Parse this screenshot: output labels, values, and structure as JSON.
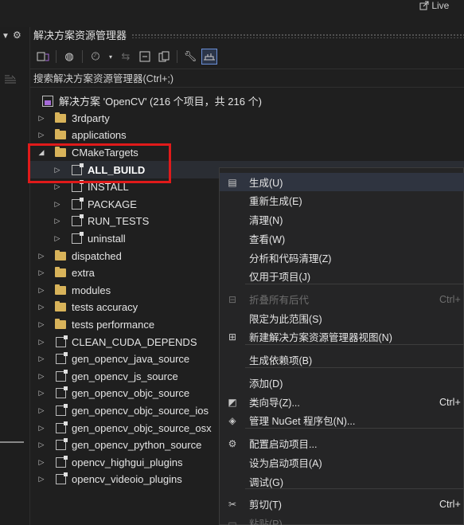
{
  "topbar": {
    "live_label": "Live"
  },
  "panel": {
    "title": "解决方案资源管理器",
    "search_placeholder": "搜索解决方案资源管理器(Ctrl+;)"
  },
  "tree": {
    "solution": "解决方案 'OpenCV' (216 个项目，共 216 个)",
    "items": [
      {
        "label": "3rdparty",
        "type": "folder"
      },
      {
        "label": "applications",
        "type": "folder"
      },
      {
        "label": "CMakeTargets",
        "type": "folder"
      },
      {
        "label": "ALL_BUILD",
        "type": "project"
      },
      {
        "label": "INSTALL",
        "type": "project"
      },
      {
        "label": "PACKAGE",
        "type": "project"
      },
      {
        "label": "RUN_TESTS",
        "type": "project"
      },
      {
        "label": "uninstall",
        "type": "project"
      },
      {
        "label": "dispatched",
        "type": "folder"
      },
      {
        "label": "extra",
        "type": "folder"
      },
      {
        "label": "modules",
        "type": "folder"
      },
      {
        "label": "tests accuracy",
        "type": "folder"
      },
      {
        "label": "tests performance",
        "type": "folder"
      },
      {
        "label": "CLEAN_CUDA_DEPENDS",
        "type": "project"
      },
      {
        "label": "gen_opencv_java_source",
        "type": "project"
      },
      {
        "label": "gen_opencv_js_source",
        "type": "project"
      },
      {
        "label": "gen_opencv_objc_source",
        "type": "project"
      },
      {
        "label": "gen_opencv_objc_source_ios",
        "type": "project"
      },
      {
        "label": "gen_opencv_objc_source_osx",
        "type": "project"
      },
      {
        "label": "gen_opencv_python_source",
        "type": "project"
      },
      {
        "label": "opencv_highgui_plugins",
        "type": "project"
      },
      {
        "label": "opencv_videoio_plugins",
        "type": "project"
      }
    ]
  },
  "menu": {
    "items": [
      {
        "label": "生成(U)",
        "shortcut": "",
        "icon": "build-icon",
        "disabled": false
      },
      {
        "label": "重新生成(E)",
        "shortcut": "",
        "icon": "",
        "disabled": false
      },
      {
        "label": "清理(N)",
        "shortcut": "",
        "icon": "",
        "disabled": false
      },
      {
        "label": "查看(W)",
        "shortcut": "",
        "icon": "",
        "disabled": false
      },
      {
        "label": "分析和代码清理(Z)",
        "shortcut": "",
        "icon": "",
        "disabled": false
      },
      {
        "label": "仅用于项目(J)",
        "shortcut": "",
        "icon": "",
        "disabled": false
      },
      {
        "label": "折叠所有后代",
        "shortcut": "Ctrl+",
        "icon": "collapse-icon",
        "disabled": true
      },
      {
        "label": "限定为此范围(S)",
        "shortcut": "",
        "icon": "",
        "disabled": false
      },
      {
        "label": "新建解决方案资源管理器视图(N)",
        "shortcut": "",
        "icon": "new-view-icon",
        "disabled": false
      },
      {
        "label": "生成依赖项(B)",
        "shortcut": "",
        "icon": "",
        "disabled": false
      },
      {
        "label": "添加(D)",
        "shortcut": "",
        "icon": "",
        "disabled": false
      },
      {
        "label": "类向导(Z)...",
        "shortcut": "Ctrl+",
        "icon": "class-wizard-icon",
        "disabled": false
      },
      {
        "label": "管理 NuGet 程序包(N)...",
        "shortcut": "",
        "icon": "nuget-icon",
        "disabled": false
      },
      {
        "label": "配置启动项目...",
        "shortcut": "",
        "icon": "gear-icon",
        "disabled": false
      },
      {
        "label": "设为启动项目(A)",
        "shortcut": "",
        "icon": "",
        "disabled": false
      },
      {
        "label": "调试(G)",
        "shortcut": "",
        "icon": "",
        "disabled": false
      },
      {
        "label": "剪切(T)",
        "shortcut": "Ctrl+",
        "icon": "scissors-icon",
        "disabled": false
      },
      {
        "label": "粘贴(P)",
        "shortcut": "",
        "icon": "paste-icon",
        "disabled": true
      }
    ]
  },
  "colors": {
    "highlight_box": "#e01a1a",
    "folder": "#d8b35a",
    "background": "#1f1f1f"
  }
}
